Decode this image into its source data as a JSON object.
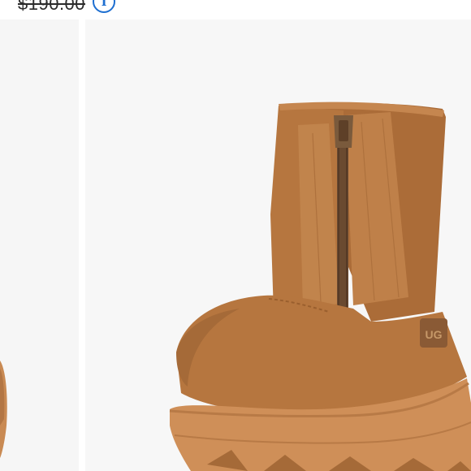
{
  "listing": {
    "original_price": "$190.00",
    "info_icon": "info-icon",
    "info_glyph": "i"
  },
  "gallery": {
    "slides": [
      "previous-product-photo",
      "boot-product-photo"
    ]
  },
  "boot": {
    "brand_tab": "UG",
    "colors": {
      "suede": "#b6763f",
      "suede_dark": "#9a5f2e",
      "sole": "#cf8f58",
      "sole_shadow": "#a56a38",
      "zipper": "#6a4a30",
      "tab": "#8a5a35",
      "accent_blue": "#1e6fd1"
    }
  }
}
